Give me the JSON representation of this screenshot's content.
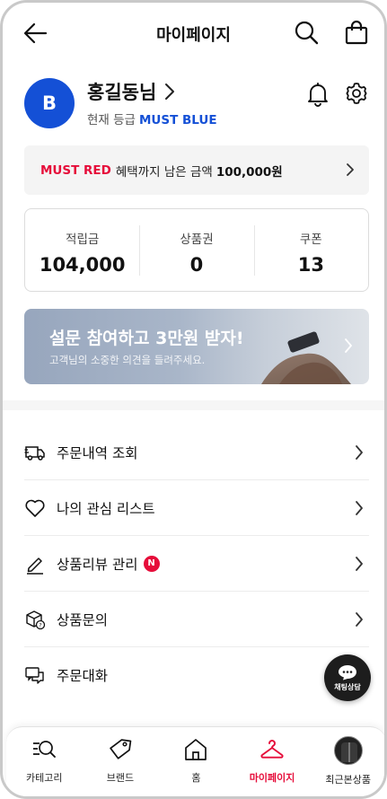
{
  "header": {
    "title": "마이페이지"
  },
  "profile": {
    "avatar_letter": "B",
    "name": "홍길동님",
    "grade_label": "현재 등급",
    "grade_value": "MUST BLUE"
  },
  "must_red": {
    "grade": "MUST RED",
    "text": "혜택까지 남은 금액",
    "amount": "100,000원"
  },
  "stats": [
    {
      "label": "적립금",
      "value": "104,000"
    },
    {
      "label": "상품권",
      "value": "0"
    },
    {
      "label": "쿠폰",
      "value": "13"
    }
  ],
  "survey": {
    "title": "설문 참여하고 3만원 받자!",
    "subtitle": "고객님의 소중한 의견을 들려주세요."
  },
  "menu": [
    {
      "label": "주문내역 조회",
      "icon": "truck-icon"
    },
    {
      "label": "나의 관심 리스트",
      "icon": "heart-icon"
    },
    {
      "label": "상품리뷰 관리",
      "icon": "pencil-icon",
      "badge": "N"
    },
    {
      "label": "상품문의",
      "icon": "box-question-icon"
    },
    {
      "label": "주문대화",
      "icon": "chat-bubbles-icon"
    }
  ],
  "chat_button": {
    "label": "채팅상담"
  },
  "bottom_nav": [
    {
      "label": "카테고리",
      "icon": "category-search-icon"
    },
    {
      "label": "브랜드",
      "icon": "tag-icon"
    },
    {
      "label": "홈",
      "icon": "home-icon"
    },
    {
      "label": "마이페이지",
      "icon": "hanger-icon",
      "active": true
    },
    {
      "label": "최근본상품",
      "icon": "recent-product-thumbnail"
    }
  ],
  "colors": {
    "brand_blue": "#1450d6",
    "accent_red": "#e60d3a",
    "banner_bg": "#f4f4f4"
  }
}
